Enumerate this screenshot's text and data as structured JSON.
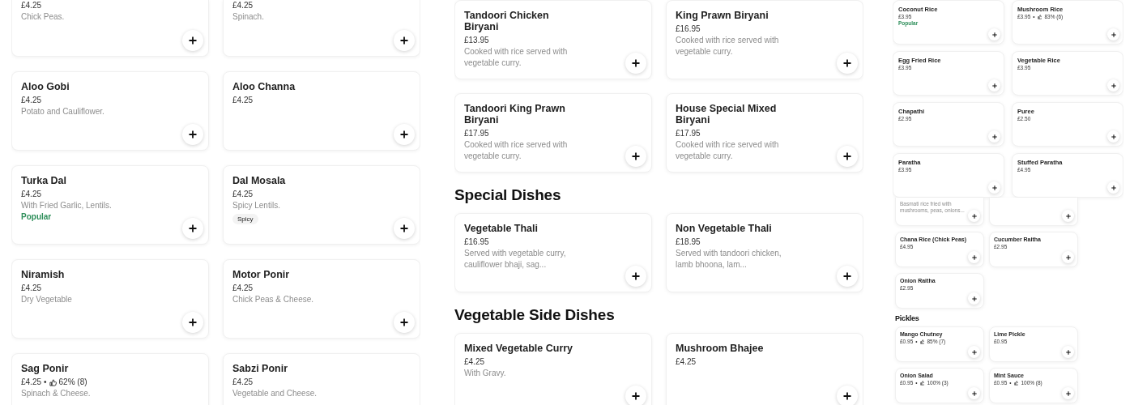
{
  "panels": [
    {
      "sections": [
        {
          "items": [
            {
              "price": "£4.25",
              "description": "Chick Peas.",
              "add": true
            },
            {
              "price": "£4.25",
              "description": "Spinach.",
              "add": true
            },
            {
              "name": "Aloo Gobi",
              "price": "£4.25",
              "description": "Potato and Cauliflower.",
              "add": true
            },
            {
              "name": "Aloo Channa",
              "price": "£4.25",
              "add": true
            },
            {
              "name": "Turka Dal",
              "price": "£4.25",
              "description": "With Fried Garlic, Lentils.",
              "badge": "Popular",
              "add": true
            },
            {
              "name": "Dal Mosala",
              "price": "£4.25",
              "description": "Spicy Lentils.",
              "tag": "Spicy",
              "add": true
            },
            {
              "name": "Niramish",
              "price": "£4.25",
              "description": "Dry Vegetable",
              "add": true
            },
            {
              "name": "Motor Ponir",
              "price": "£4.25",
              "description": "Chick Peas & Cheese.",
              "add": true
            },
            {
              "name": "Sag Ponir",
              "price": "£4.25",
              "separator": "•",
              "rating": "62% (8)",
              "description": "Spinach & Cheese.",
              "add": false
            },
            {
              "name": "Sabzi Ponir",
              "price": "£4.25",
              "description": "Vegetable and Cheese.",
              "add": false
            }
          ]
        }
      ]
    },
    {
      "sections": [
        {
          "items": [
            {
              "name": "Tandoori Chicken Biryani",
              "price": "£13.95",
              "description": "Cooked with rice served with vegetable curry.",
              "add": true
            },
            {
              "name": "King Prawn Biryani",
              "price": "£16.95",
              "description": "Cooked with rice served with vegetable curry.",
              "add": true
            },
            {
              "name": "Tandoori King Prawn Biryani",
              "price": "£17.95",
              "description": "Cooked with rice served with vegetable curry.",
              "add": true
            },
            {
              "name": "House Special Mixed Biryani",
              "price": "£17.95",
              "description": "Cooked with rice served with vegetable curry.",
              "add": true
            }
          ]
        },
        {
          "heading": "Special Dishes",
          "items": [
            {
              "name": "Vegetable Thali",
              "price": "£16.95",
              "description": "Served with vegetable curry, cauliflower bhaji, sag...",
              "add": true
            },
            {
              "name": "Non Vegetable Thali",
              "price": "£18.95",
              "description": "Served with tandoori chicken, lamb bhoona, lam...",
              "add": true
            }
          ]
        },
        {
          "heading": "Vegetable Side Dishes",
          "items": [
            {
              "name": "Mixed Vegetable Curry",
              "price": "£4.25",
              "description": "With Gravy.",
              "add": true
            },
            {
              "name": "Mushroom Bhajee",
              "price": "£4.25",
              "add": true
            }
          ]
        }
      ]
    },
    {
      "sections": [
        {
          "items": [
            {
              "name": "Coconut Rice",
              "price": "£3.95",
              "badge": "Popular",
              "add": true
            },
            {
              "name": "Mushroom Rice",
              "price": "£3.95",
              "separator": "•",
              "rating": "83% (6)",
              "add": true
            },
            {
              "name": "Egg Fried Rice",
              "price": "£3.95",
              "add": true
            },
            {
              "name": "Vegetable Rice",
              "price": "£3.95",
              "add": true
            },
            {
              "name": "Chapathi",
              "price": "£2.95",
              "add": true
            },
            {
              "name": "Puree",
              "price": "£2.50",
              "add": true
            },
            {
              "name": "Paratha",
              "price": "£3.95",
              "add": true
            },
            {
              "name": "Stuffed Paratha",
              "price": "£4.95",
              "add": true
            }
          ]
        }
      ]
    },
    {
      "sections": [
        {
          "items": [
            {
              "description": "Basmati rice fried with mushrooms, peas, onions...",
              "add": true
            },
            {
              "add": true
            },
            {
              "name": "Chana Rice (Chick Peas)",
              "price": "£4.95",
              "add": true
            },
            {
              "name": "Cucumber Raitha",
              "price": "£2.95",
              "add": true
            },
            {
              "name": "Onion Raitha",
              "price": "£2.95",
              "add": true
            }
          ]
        },
        {
          "heading": "Pickles",
          "items": [
            {
              "name": "Mango Chutney",
              "price": "£0.95",
              "separator": "•",
              "rating": "85% (7)",
              "add": true
            },
            {
              "name": "Lime Pickle",
              "price": "£0.95",
              "add": true
            },
            {
              "name": "Onion Salad",
              "price": "£0.95",
              "separator": "•",
              "rating": "100% (3)",
              "add": true
            },
            {
              "name": "Mint Sauce",
              "price": "£0.95",
              "separator": "•",
              "rating": "100% (8)",
              "add": true
            }
          ]
        }
      ]
    }
  ]
}
